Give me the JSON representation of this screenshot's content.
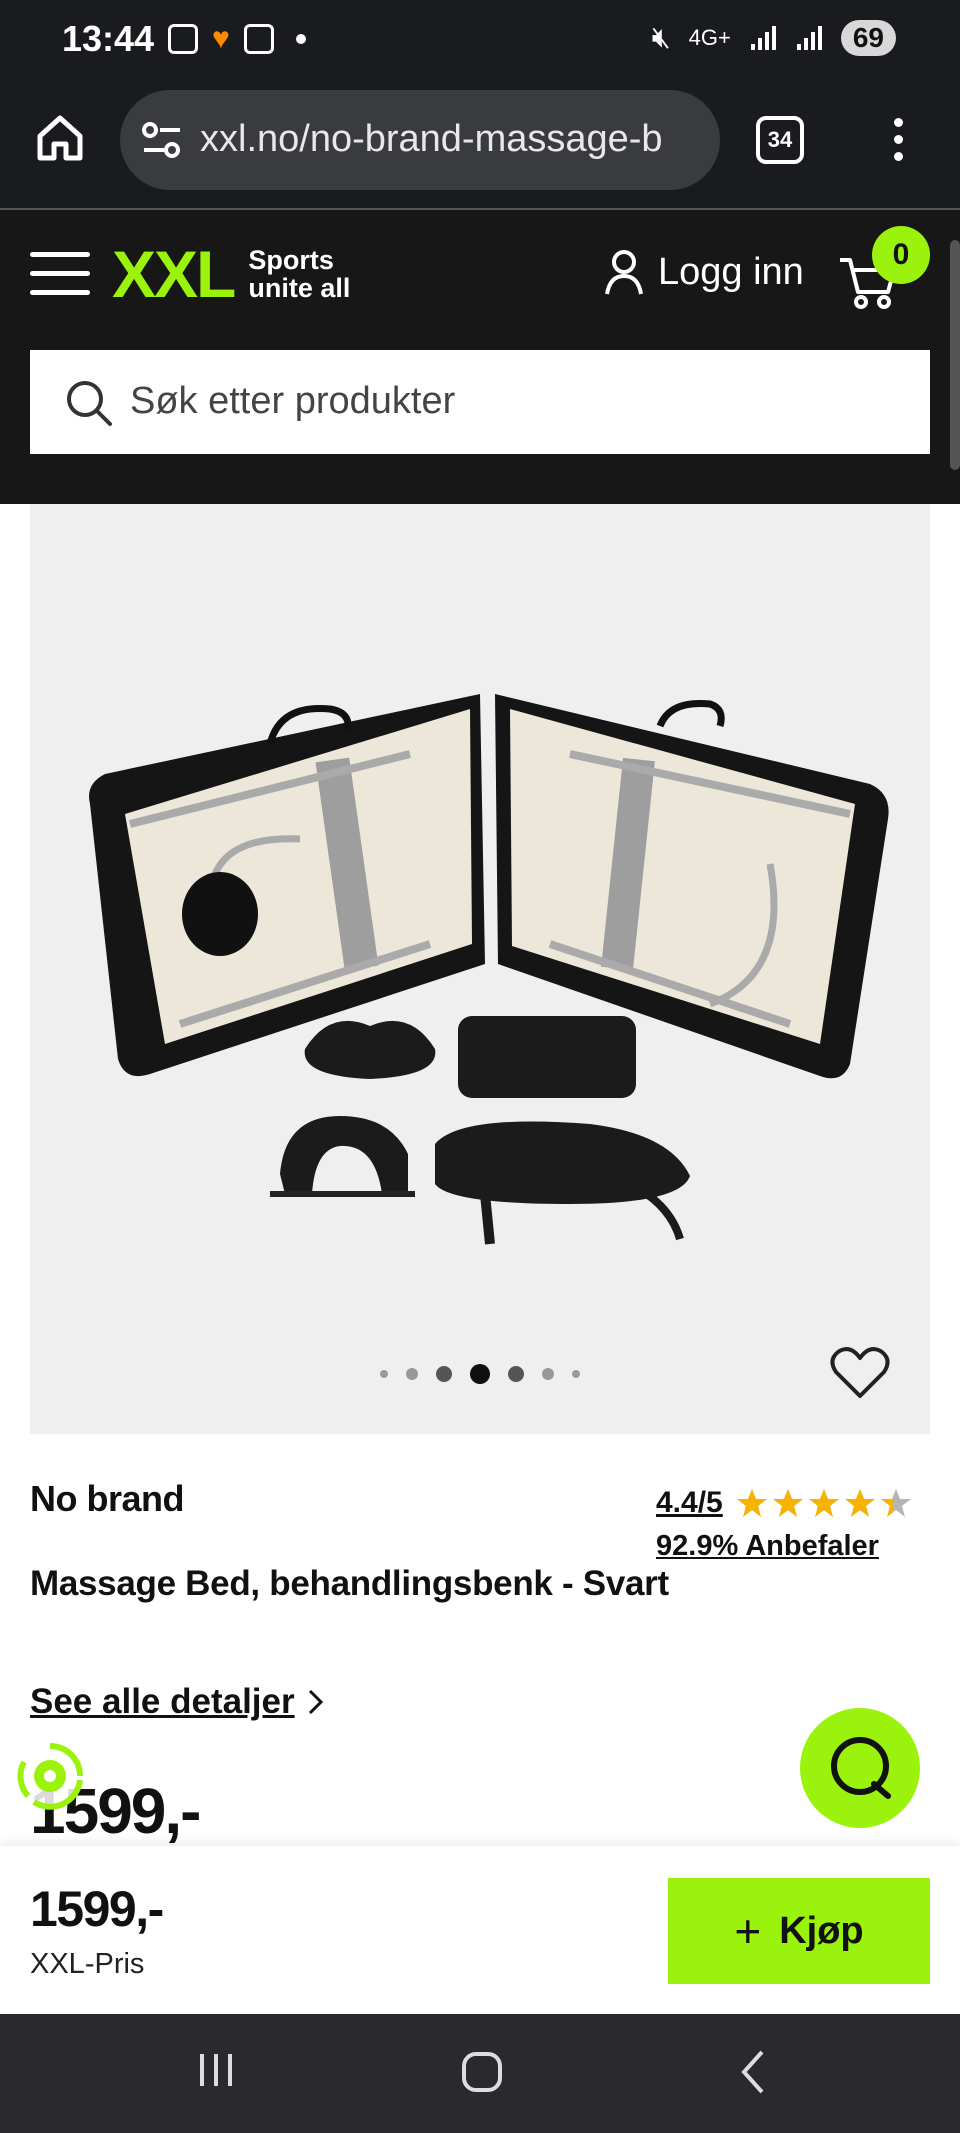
{
  "status_bar": {
    "time": "13:44",
    "network": "4G+",
    "battery": "69"
  },
  "browser": {
    "url": "xxl.no/no-brand-massage-b",
    "tab_count": "34"
  },
  "site": {
    "logo_text": "XXL",
    "tagline_1": "Sports",
    "tagline_2": "unite all",
    "login_label": "Logg inn",
    "cart_count": "0",
    "search_placeholder": "Søk etter produkter"
  },
  "gallery": {
    "total_images": 7,
    "active_index": 3
  },
  "product": {
    "brand": "No brand",
    "rating": "4.4/5",
    "rating_value": 4.4,
    "rating_max": 5,
    "recommend": "92.9% Anbefaler",
    "title": "Massage Bed, behandlingsbenk - Svart",
    "details_link": "See alle detaljer",
    "price_partial": "1599,-"
  },
  "buy_bar": {
    "price": "1599,-",
    "price_label": "XXL-Pris",
    "buy_label": "Kjøp"
  },
  "colors": {
    "accent": "#9bf20d",
    "header_bg": "#171717",
    "star": "#f6b400"
  }
}
